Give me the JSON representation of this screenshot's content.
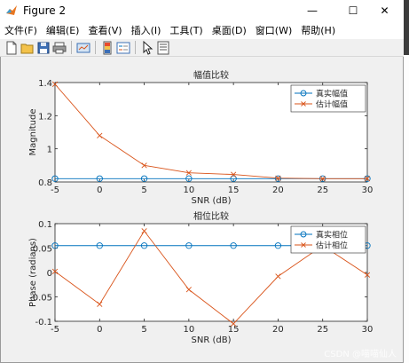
{
  "window": {
    "title": "Figure 2",
    "controls": {
      "minimize": "—",
      "maximize": "☐",
      "close": "✕"
    }
  },
  "menu": [
    {
      "label": "文件(F)"
    },
    {
      "label": "编辑(E)"
    },
    {
      "label": "查看(V)"
    },
    {
      "label": "插入(I)"
    },
    {
      "label": "工具(T)"
    },
    {
      "label": "桌面(D)"
    },
    {
      "label": "窗口(W)"
    },
    {
      "label": "帮助(H)"
    }
  ],
  "toolbar": [
    {
      "name": "new-figure-icon"
    },
    {
      "name": "open-file-icon"
    },
    {
      "name": "save-icon"
    },
    {
      "name": "print-icon"
    },
    {
      "sep": true
    },
    {
      "name": "link-plot-icon"
    },
    {
      "sep": true
    },
    {
      "name": "colorbar-icon"
    },
    {
      "name": "legend-icon"
    },
    {
      "sep": true
    },
    {
      "name": "pointer-icon"
    },
    {
      "name": "property-inspector-icon"
    }
  ],
  "watermark": "CSDN @喵喵仙人",
  "colors": {
    "true_series": "#0072bd",
    "est_series": "#d95319"
  },
  "chart_data": [
    {
      "type": "line",
      "title": "幅值比较",
      "xlabel": "SNR (dB)",
      "ylabel": "Magnitude",
      "xlim": [
        -5,
        30
      ],
      "ylim": [
        0.8,
        1.4
      ],
      "x": [
        -5,
        0,
        5,
        10,
        15,
        20,
        25,
        30
      ],
      "xticks": [
        "-5",
        "0",
        "5",
        "10",
        "15",
        "20",
        "25",
        "30"
      ],
      "yticks": [
        0.8,
        1.0,
        1.2,
        1.4
      ],
      "yticklabels": [
        "0.8",
        "1",
        "1.2",
        "1.4"
      ],
      "series": [
        {
          "name": "真实幅值",
          "values": [
            0.82,
            0.82,
            0.82,
            0.82,
            0.82,
            0.82,
            0.82,
            0.82
          ],
          "marker": "circle"
        },
        {
          "name": "估计幅值",
          "values": [
            1.39,
            1.08,
            0.9,
            0.855,
            0.845,
            0.823,
            0.82,
            0.82
          ],
          "marker": "x"
        }
      ],
      "legend": "top-right",
      "grid": false
    },
    {
      "type": "line",
      "title": "相位比较",
      "xlabel": "SNR (dB)",
      "ylabel": "Phase (radians)",
      "xlim": [
        -5,
        30
      ],
      "ylim": [
        -0.1,
        0.1
      ],
      "x": [
        -5,
        0,
        5,
        10,
        15,
        20,
        25,
        30
      ],
      "xticks": [
        "-5",
        "0",
        "5",
        "10",
        "15",
        "20",
        "25",
        "30"
      ],
      "yticks": [
        -0.1,
        -0.05,
        0,
        0.05,
        0.1
      ],
      "yticklabels": [
        "-0.1",
        "-0.05",
        "0",
        "0.05",
        "0.1"
      ],
      "series": [
        {
          "name": "真实相位",
          "values": [
            0.055,
            0.055,
            0.055,
            0.055,
            0.055,
            0.055,
            0.055,
            0.055
          ],
          "marker": "circle"
        },
        {
          "name": "估计相位",
          "values": [
            0.002,
            -0.065,
            0.085,
            -0.035,
            -0.105,
            -0.008,
            0.055,
            -0.005
          ],
          "marker": "x"
        }
      ],
      "legend": "top-right",
      "grid": false
    }
  ]
}
